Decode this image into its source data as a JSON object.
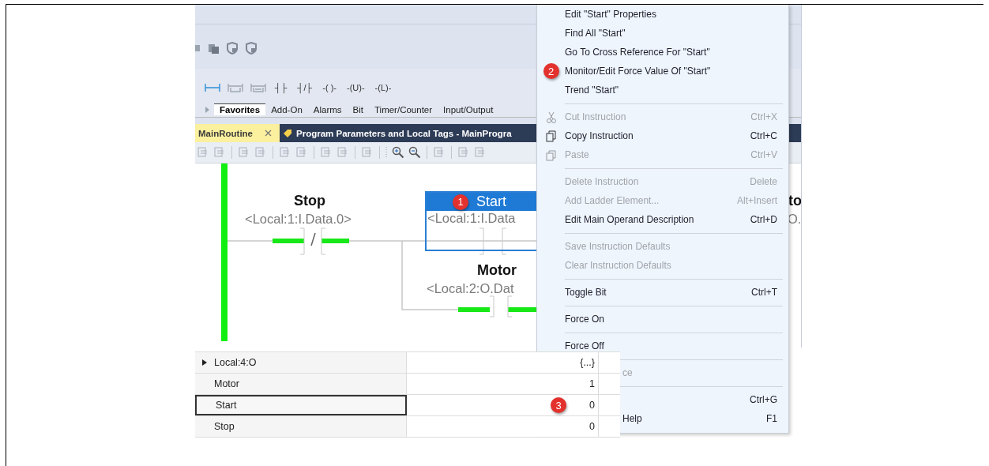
{
  "quick_toolbar": {
    "icons": [
      {
        "kind": "partial"
      },
      {
        "kind": "tags"
      },
      {
        "kind": "shield"
      },
      {
        "kind": "shield"
      }
    ]
  },
  "instruction_toolbar": {
    "items": [
      {
        "kind": "branch",
        "selected": true
      },
      {
        "kind": "branch-level",
        "selected": false
      },
      {
        "kind": "branch-nested",
        "selected": false
      },
      {
        "kind": "text",
        "label": "┤├"
      },
      {
        "kind": "text",
        "label": "┤/├"
      },
      {
        "kind": "text",
        "label": "-( )-"
      },
      {
        "kind": "text",
        "label": "-(U)-"
      },
      {
        "kind": "text",
        "label": "-(L)-"
      }
    ]
  },
  "palette_tabs": [
    {
      "label": "Favorites",
      "selected": true
    },
    {
      "label": "Add-On",
      "selected": false
    },
    {
      "label": "Alarms",
      "selected": false
    },
    {
      "label": "Bit",
      "selected": false
    },
    {
      "label": "Timer/Counter",
      "selected": false
    },
    {
      "label": "Input/Output",
      "selected": false
    }
  ],
  "document_tabs": [
    {
      "label": "MainRoutine",
      "selected": true,
      "closable": true
    },
    {
      "label": "Program Parameters and Local Tags - MainProgra",
      "selected": false,
      "closable": false
    }
  ],
  "ladder": {
    "stop": {
      "name": "Stop",
      "address": "<Local:1:I.Data.0>"
    },
    "start": {
      "name": "Start",
      "address": "<Local:1:I.Data",
      "selected": true,
      "badge": "1"
    },
    "motor": {
      "name": "Motor",
      "address": "<Local:2:O.Dat"
    },
    "output": {
      "name": "to",
      "address": "O."
    }
  },
  "context_menu": {
    "items": [
      {
        "kind": "item",
        "label": "Edit \"Start\" Properties",
        "disabled": false
      },
      {
        "kind": "item",
        "label": "Find All \"Start\"",
        "disabled": false
      },
      {
        "kind": "item",
        "label": "Go To Cross Reference For \"Start\"",
        "disabled": false
      },
      {
        "kind": "item",
        "label": "Monitor/Edit Force Value Of \"Start\"",
        "disabled": false,
        "badge": "2"
      },
      {
        "kind": "item",
        "label": "Trend \"Start\"",
        "disabled": false
      },
      {
        "kind": "separator"
      },
      {
        "kind": "cut",
        "label": "Cut Instruction",
        "shortcut": "Ctrl+X",
        "disabled": true
      },
      {
        "kind": "copy",
        "label": "Copy Instruction",
        "shortcut": "Ctrl+C",
        "disabled": false
      },
      {
        "kind": "paste",
        "label": "Paste",
        "shortcut": "Ctrl+V",
        "disabled": true
      },
      {
        "kind": "separator"
      },
      {
        "kind": "item",
        "label": "Delete Instruction",
        "shortcut": "Delete",
        "disabled": true
      },
      {
        "kind": "item",
        "label": "Add Ladder Element...",
        "shortcut": "Alt+Insert",
        "disabled": true
      },
      {
        "kind": "item",
        "label": "Edit Main Operand Description",
        "shortcut": "Ctrl+D",
        "disabled": false
      },
      {
        "kind": "separator"
      },
      {
        "kind": "item",
        "label": "Save Instruction Defaults",
        "disabled": true
      },
      {
        "kind": "item",
        "label": "Clear Instruction Defaults",
        "disabled": true
      },
      {
        "kind": "separator"
      },
      {
        "kind": "item",
        "label": "Toggle Bit",
        "shortcut": "Ctrl+T",
        "disabled": false
      },
      {
        "kind": "separator"
      },
      {
        "kind": "item",
        "label": "Force On",
        "disabled": false
      },
      {
        "kind": "separator"
      },
      {
        "kind": "item",
        "label": "Force Off",
        "disabled": false
      },
      {
        "kind": "separator"
      },
      {
        "kind": "partial",
        "label": "ce",
        "disabled": true
      },
      {
        "kind": "separator"
      },
      {
        "kind": "partial",
        "shortcut": "Ctrl+G",
        "disabled": false
      },
      {
        "kind": "partial",
        "label": "Help",
        "shortcut": "F1",
        "disabled": false
      }
    ]
  },
  "tag_table": {
    "rows": [
      {
        "kind": "group",
        "name": "Local:4:O",
        "value": "{...}",
        "expanded": false,
        "selected": false
      },
      {
        "kind": "tag",
        "name": "Motor",
        "value": "1",
        "selected": false
      },
      {
        "kind": "tag",
        "name": "Start",
        "value": "0",
        "selected": true,
        "badge": "3"
      },
      {
        "kind": "tag",
        "name": "Stop",
        "value": "0",
        "selected": false
      }
    ]
  }
}
